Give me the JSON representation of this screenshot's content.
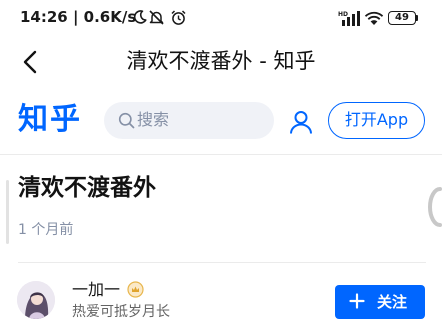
{
  "status_bar": {
    "time_speed": "14:26 | 0.6K/s",
    "battery_level": "49",
    "network_label": "HD"
  },
  "title_bar": {
    "title": "清欢不渡番外 - 知乎"
  },
  "header": {
    "logo_text": "知乎",
    "search_placeholder": "搜索",
    "open_app_label": "打开App",
    "brand_color": "#0066ff"
  },
  "article": {
    "title": "清欢不渡番外",
    "published": "1 个月前"
  },
  "author": {
    "name": "一加一",
    "bio": "热爱可抵岁月长",
    "follow_label": "关注"
  },
  "icons": [
    "back-arrow-icon",
    "moon-icon",
    "mute-icon",
    "alarm-icon",
    "signal-icon",
    "wifi-icon",
    "search-icon",
    "user-icon",
    "badge-icon",
    "plus-icon"
  ]
}
